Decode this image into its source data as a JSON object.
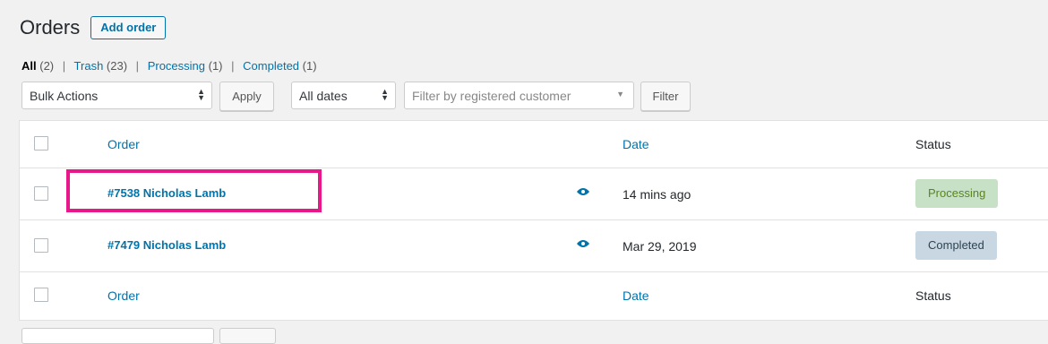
{
  "header": {
    "title": "Orders",
    "add_label": "Add order"
  },
  "filters": {
    "all": "All",
    "all_count": "(2)",
    "trash": "Trash",
    "trash_count": "(23)",
    "processing": "Processing",
    "processing_count": "(1)",
    "completed": "Completed",
    "completed_count": "(1)",
    "sep": "|"
  },
  "toolbar": {
    "bulk_actions": "Bulk Actions",
    "apply": "Apply",
    "dates": "All dates",
    "customer_placeholder": "Filter by registered customer",
    "filter": "Filter"
  },
  "table": {
    "headers": {
      "order": "Order",
      "date": "Date",
      "status": "Status"
    },
    "rows": [
      {
        "order": "#7538 Nicholas Lamb",
        "date": "14 mins ago",
        "status": "Processing"
      },
      {
        "order": "#7479 Nicholas Lamb",
        "date": "Mar 29, 2019",
        "status": "Completed"
      }
    ],
    "footer": {
      "order": "Order",
      "date": "Date",
      "status": "Status"
    }
  },
  "icons": {
    "preview": "eye-icon",
    "select_arrows": "updown-arrows-icon",
    "dropdown": "caret-down-icon"
  },
  "colors": {
    "link": "#0073aa",
    "highlight": "#e8178a",
    "processing_bg": "#c6e1c6",
    "completed_bg": "#c8d7e1"
  }
}
